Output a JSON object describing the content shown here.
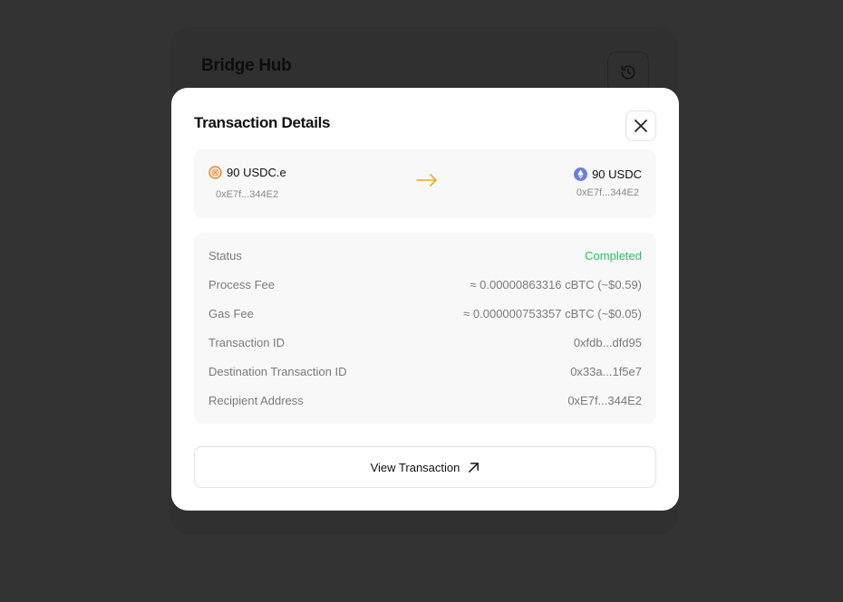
{
  "background": {
    "title": "Bridge Hub",
    "history_icon": "history-icon"
  },
  "modal": {
    "title": "Transaction Details",
    "close_icon": "close-icon",
    "transfer": {
      "from": {
        "amount": "90 USDC.e",
        "address": "0xE7f...344E2",
        "icon": "usdc-e-token-icon",
        "color": "#e8842b"
      },
      "to": {
        "amount": "90 USDC",
        "address": "0xE7f...344E2",
        "icon": "ethereum-icon",
        "color": "#6c7fd8"
      },
      "arrow_icon": "arrow-right-icon",
      "arrow_color": "#f5a623"
    },
    "details": [
      {
        "label": "Status",
        "value": "Completed"
      },
      {
        "label": "Process Fee",
        "value": "≈ 0.00000863316 cBTC (~$0.59)"
      },
      {
        "label": "Gas Fee",
        "value": "≈ 0.000000753357 cBTC (~$0.05)"
      },
      {
        "label": "Transaction ID",
        "value": "0xfdb...dfd95"
      },
      {
        "label": "Destination Transaction ID",
        "value": "0x33a...1f5e7"
      },
      {
        "label": "Recipient Address",
        "value": "0xE7f...344E2"
      }
    ],
    "view_button": {
      "label": "View Transaction",
      "icon": "external-arrow-icon"
    }
  },
  "colors": {
    "success": "#22c55e",
    "backdrop": "#333333"
  }
}
